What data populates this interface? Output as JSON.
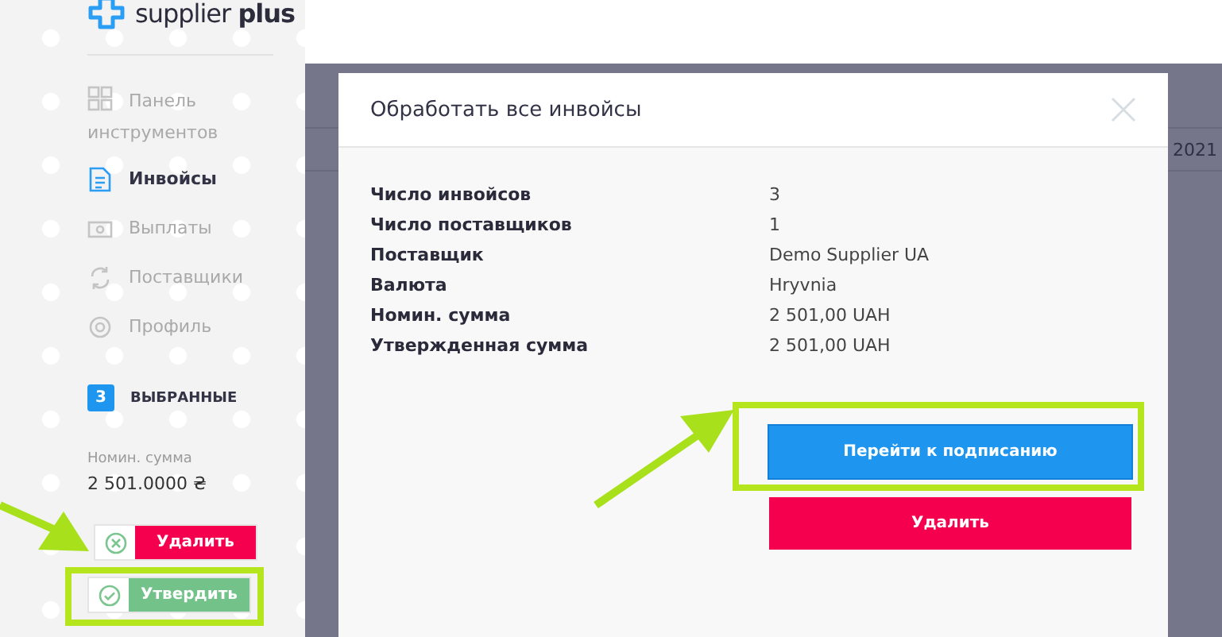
{
  "logo": {
    "text": "supplier **plus**"
  },
  "nav": [
    {
      "label": "Панель инструментов",
      "kind": "dashboard",
      "selected": false
    },
    {
      "label": "Инвойсы",
      "kind": "invoices",
      "selected": true
    },
    {
      "label": "Выплаты",
      "kind": "payouts",
      "selected": false
    },
    {
      "label": "Поставщики",
      "kind": "suppliers",
      "selected": false
    },
    {
      "label": "Профиль",
      "kind": "profile",
      "selected": false
    }
  ],
  "selection": {
    "count": "3",
    "label": "ВЫБРАННЫЕ",
    "sum_label": "Номин. сумма",
    "sum": "2 501.0000 ₴"
  },
  "sidebar_buttons": [
    {
      "label": "Удалить",
      "kind": "delete",
      "highlighted": false
    },
    {
      "label": "Утвердить",
      "kind": "approve",
      "highlighted": true
    }
  ],
  "background_rows": [
    {
      "cells": [
        "",
        "",
        "2021"
      ]
    }
  ],
  "modal": {
    "title": "Обработать все инвойсы",
    "rows": [
      {
        "label": "Число инвойсов",
        "value": "3"
      },
      {
        "label": "Число поставщиков",
        "value": "1"
      },
      {
        "label": "Поставщик",
        "value": "Demo Supplier UA"
      },
      {
        "label": "Валюта",
        "value": "Hryvnia"
      },
      {
        "label": "Номин. сумма",
        "value": "2 501,00 UAH"
      },
      {
        "label": "Утвержденная сумма",
        "value": "2 501,00 UAH"
      }
    ],
    "buttons": [
      {
        "label": "Перейти к подписанию",
        "kind": "primary",
        "highlighted": true
      },
      {
        "label": "Удалить",
        "kind": "danger",
        "highlighted": false
      }
    ]
  }
}
